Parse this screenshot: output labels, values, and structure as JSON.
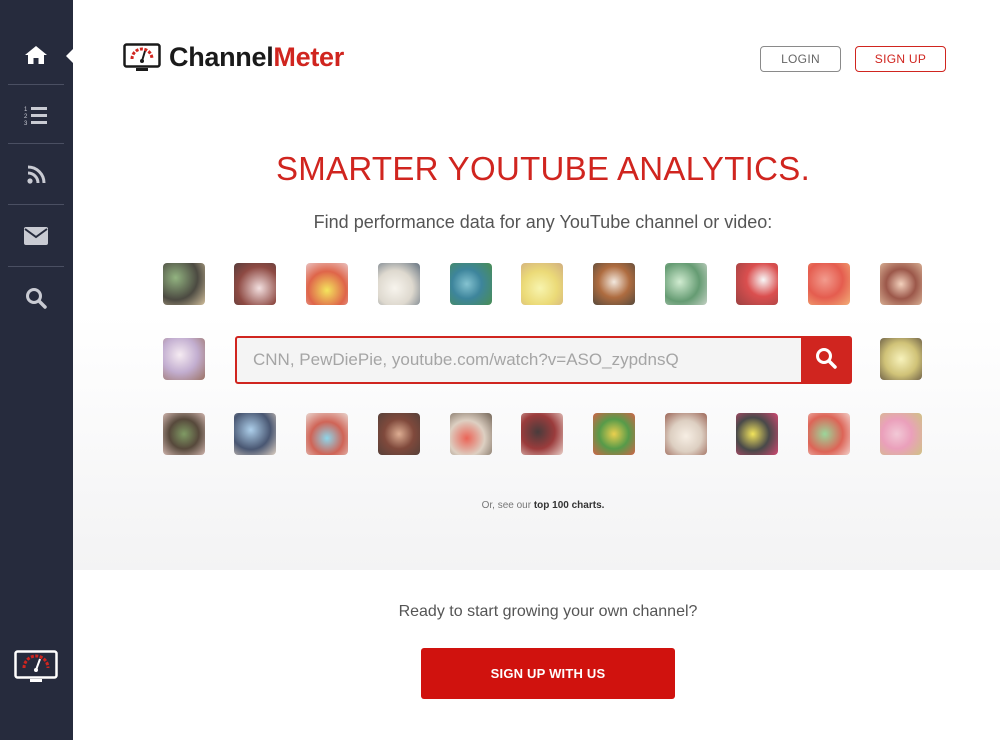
{
  "sidebar": {
    "items": [
      {
        "icon": "home-icon"
      },
      {
        "icon": "ranked-list-icon"
      },
      {
        "icon": "rss-feed-icon"
      },
      {
        "icon": "envelope-icon"
      },
      {
        "icon": "search-icon"
      }
    ],
    "logo_icon": "tv-meter-logo-icon"
  },
  "header": {
    "brand_part1": "Channel",
    "brand_part2": "Meter",
    "login_label": "LOGIN",
    "signup_label": "SIGN UP"
  },
  "hero": {
    "headline": "SMARTER YOUTUBE ANALYTICS.",
    "subline": "Find performance data for any YouTube channel or video:",
    "search_placeholder": "CNN, PewDiePie, youtube.com/watch?v=ASO_zypdnsQ",
    "charts_prefix": "Or, see our ",
    "charts_link": "top 100 charts."
  },
  "cta": {
    "text": "Ready to start growing your own channel?",
    "button_label": "SIGN UP WITH US"
  },
  "colors": {
    "accent": "#d0251f",
    "sidebar": "#262b3d",
    "cta_button": "#d0120e"
  }
}
